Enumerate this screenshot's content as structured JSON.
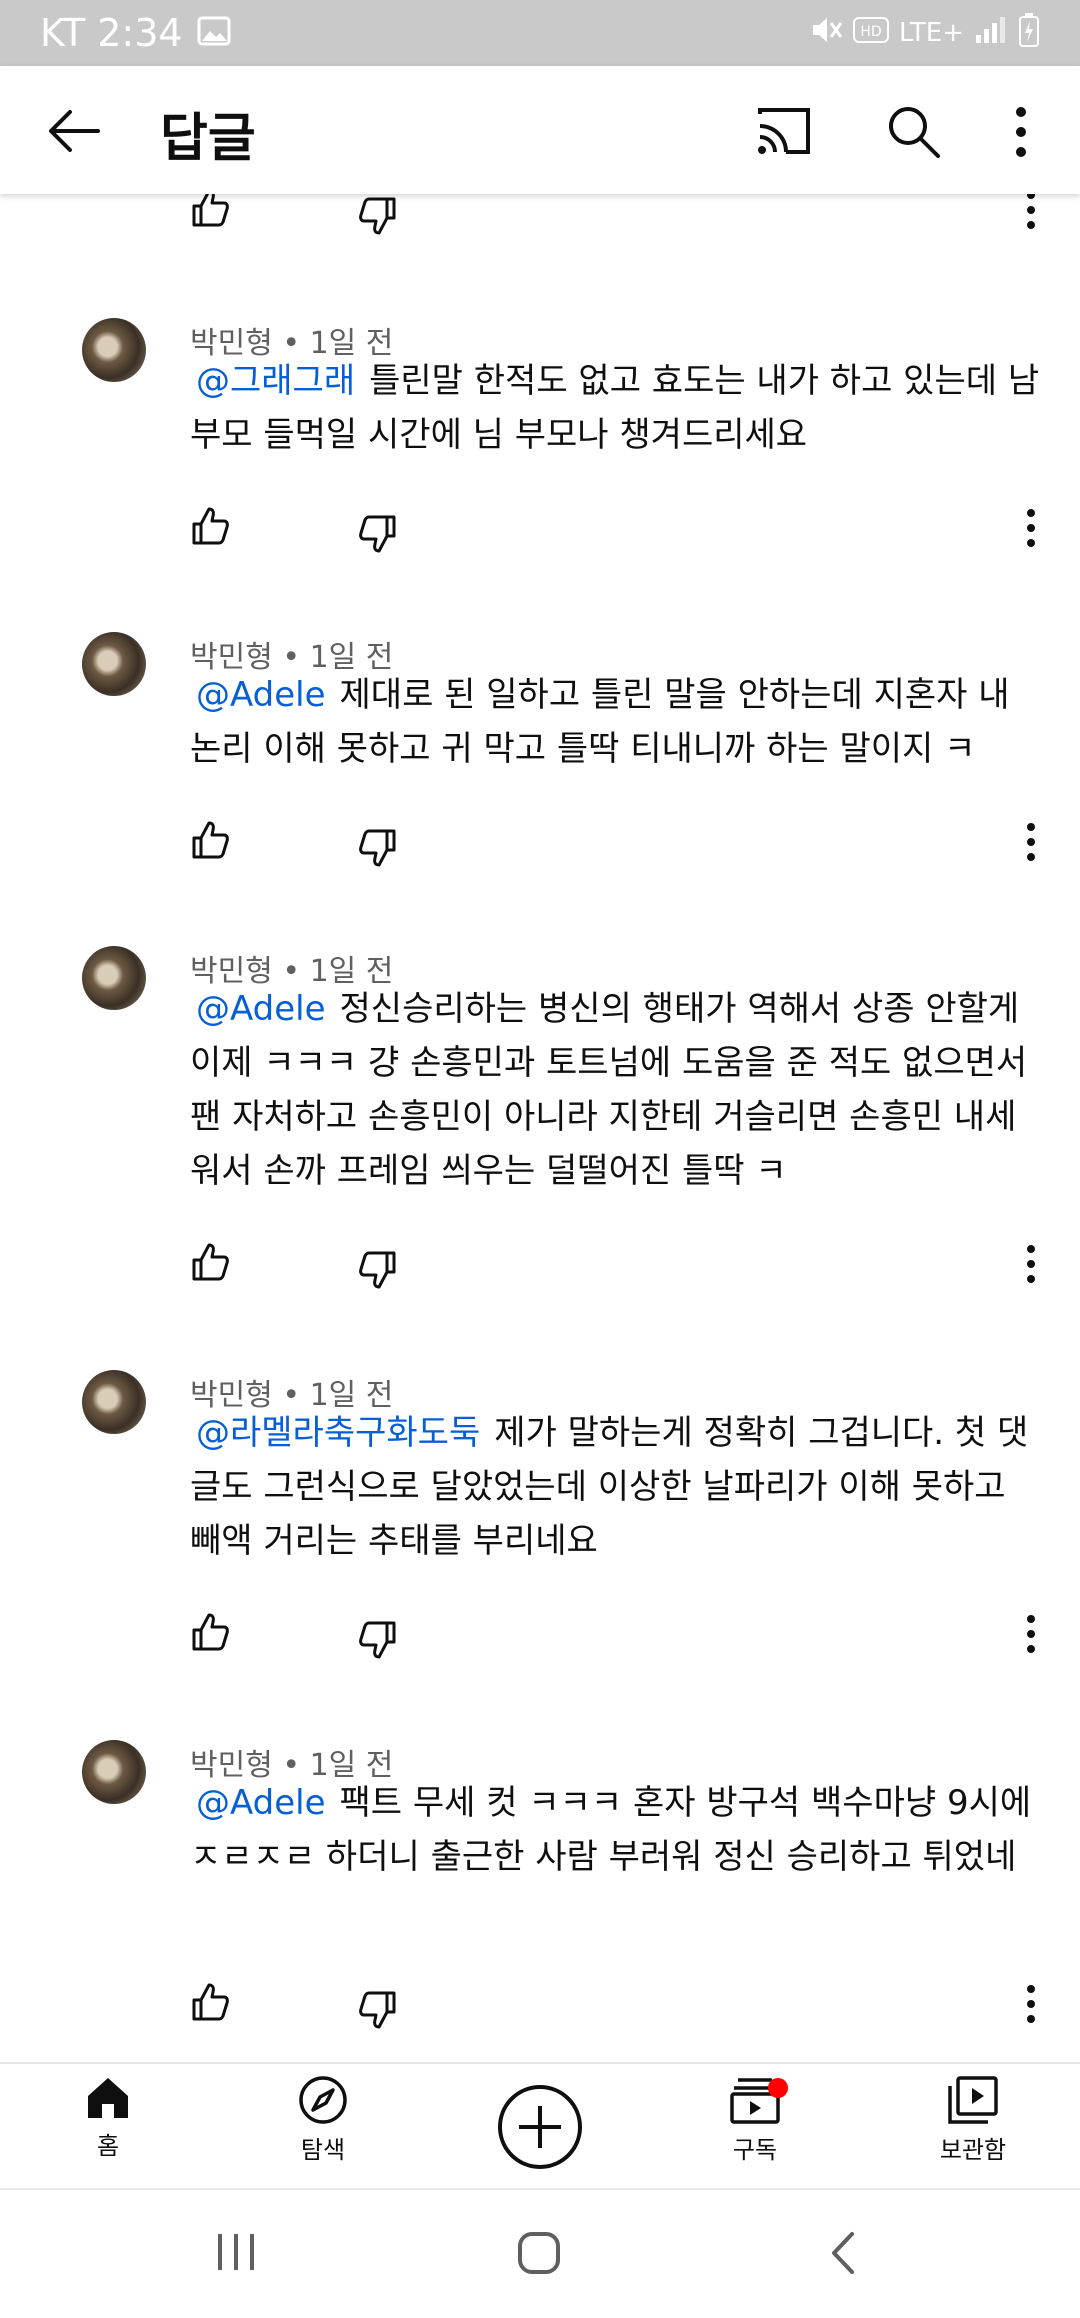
{
  "status_bar": {
    "carrier_time": "KT 2:34",
    "network": "LTE+"
  },
  "app_bar": {
    "title": "답글"
  },
  "comments": [
    {
      "author_time": "박민형 • 1일 전",
      "mention": "@그래그래",
      "text": "틀린말 한적도 없고 효도는 내가 하고 있는데 남 부모 들먹일 시간에 님 부모나 챙겨드리세요"
    },
    {
      "author_time": "박민형 • 1일 전",
      "mention": "@Adele",
      "text": "제대로 된 일하고 틀린 말을 안하는데 지혼자 내 논리 이해 못하고 귀 막고 틀딱 티내니까 하는 말이지 ㅋ"
    },
    {
      "author_time": "박민형 • 1일 전",
      "mention": "@Adele",
      "text": "정신승리하는 병신의 행태가 역해서 상종 안할게 이제 ㅋㅋㅋ 걍 손흥민과 토트넘에 도움을 준 적도 없으면서 팬 자처하고 손흥민이 아니라 지한테 거슬리면 손흥민 내세워서 손까 프레임 씌우는 덜떨어진 틀딱 ㅋ"
    },
    {
      "author_time": "박민형 • 1일 전",
      "mention": "@라멜라축구화도둑",
      "text": "제가 말하는게 정확히 그겁니다. 첫 댓글도 그런식으로 달았었는데 이상한 날파리가 이해 못하고 빼액 거리는 추태를 부리네요"
    },
    {
      "author_time": "박민형 • 1일 전",
      "mention": "@Adele",
      "text": "팩트 무세 컷 ㅋㅋㅋ 혼자 방구석 백수마냥 9시에 ㅈㄹㅈㄹ 하더니 출근한 사람 부러워 정신 승리하고 튀었네"
    }
  ],
  "bottom_nav": {
    "home": "홈",
    "explore": "탐색",
    "subscriptions": "구독",
    "library": "보관함"
  },
  "colors": {
    "mention": "#065fd4",
    "badge": "#ff0000",
    "status_bar": "#c9c9c9"
  },
  "icons": [
    "back-arrow-icon",
    "cast-icon",
    "search-icon",
    "more-vert-icon",
    "thumbs-up-icon",
    "thumbs-down-icon",
    "home-icon",
    "compass-icon",
    "add-circle-icon",
    "subscriptions-icon",
    "library-icon"
  ]
}
